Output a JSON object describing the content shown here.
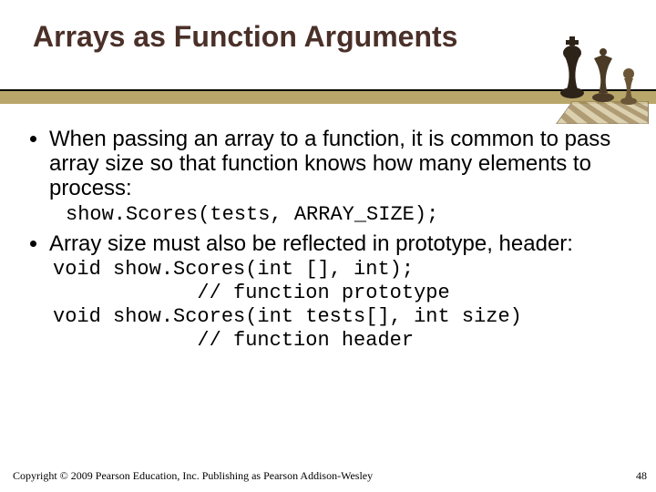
{
  "title": "Arrays as Function Arguments",
  "bullets": {
    "b1": "When passing an array to a function, it is common to pass array size so that function knows how many elements to process:",
    "code1": "show.Scores(tests, ARRAY_SIZE);",
    "b2": "Array size must also be reflected in prototype, header:",
    "code2": "void show.Scores(int [], int);\n            // function prototype\nvoid show.Scores(int tests[], int size)\n            // function header"
  },
  "footer": "Copyright © 2009 Pearson Education, Inc. Publishing as Pearson Addison-Wesley",
  "page_number": "48"
}
